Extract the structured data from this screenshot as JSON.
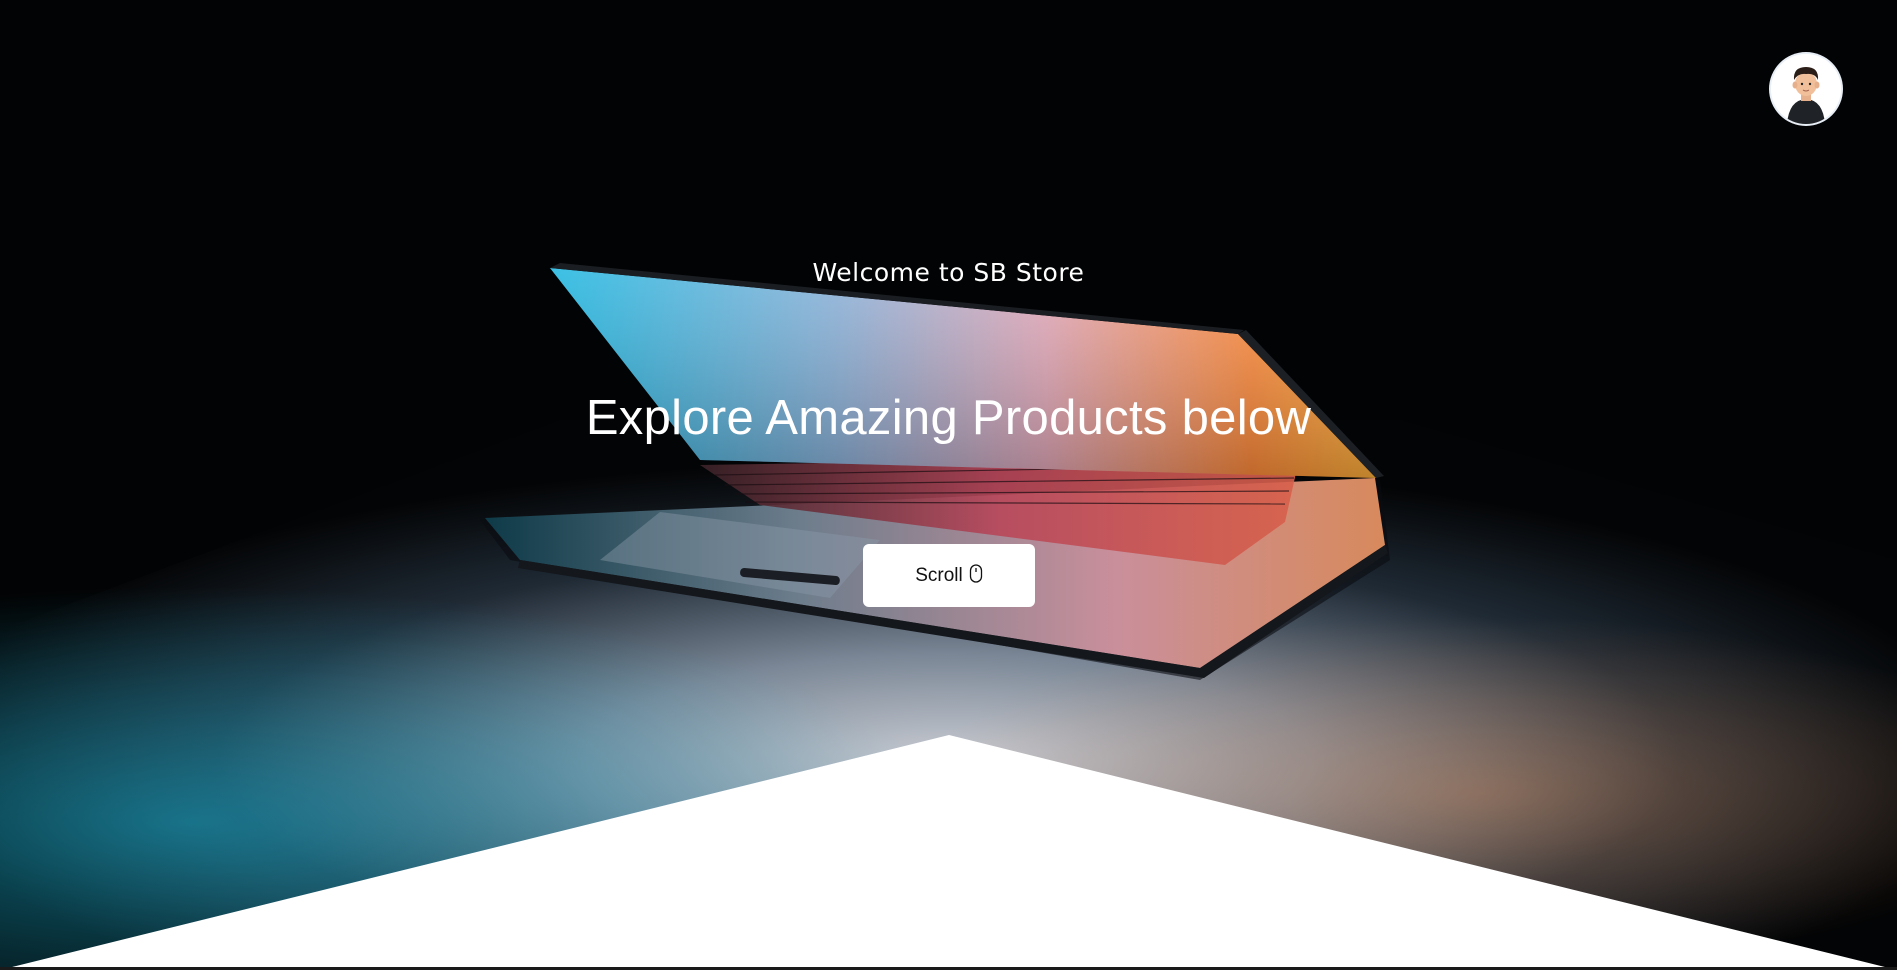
{
  "hero": {
    "welcome_text": "Welcome to SB Store",
    "headline": "Explore Amazing Products below",
    "scroll_label": "Scroll",
    "scroll_icon": "mouse-icon"
  },
  "header": {
    "avatar_icon": "user-avatar-icon"
  },
  "colors": {
    "background": "#020304",
    "text": "#ffffff",
    "button_bg": "#ffffff",
    "button_text": "#111111",
    "divider_shape": "#ffffff"
  }
}
